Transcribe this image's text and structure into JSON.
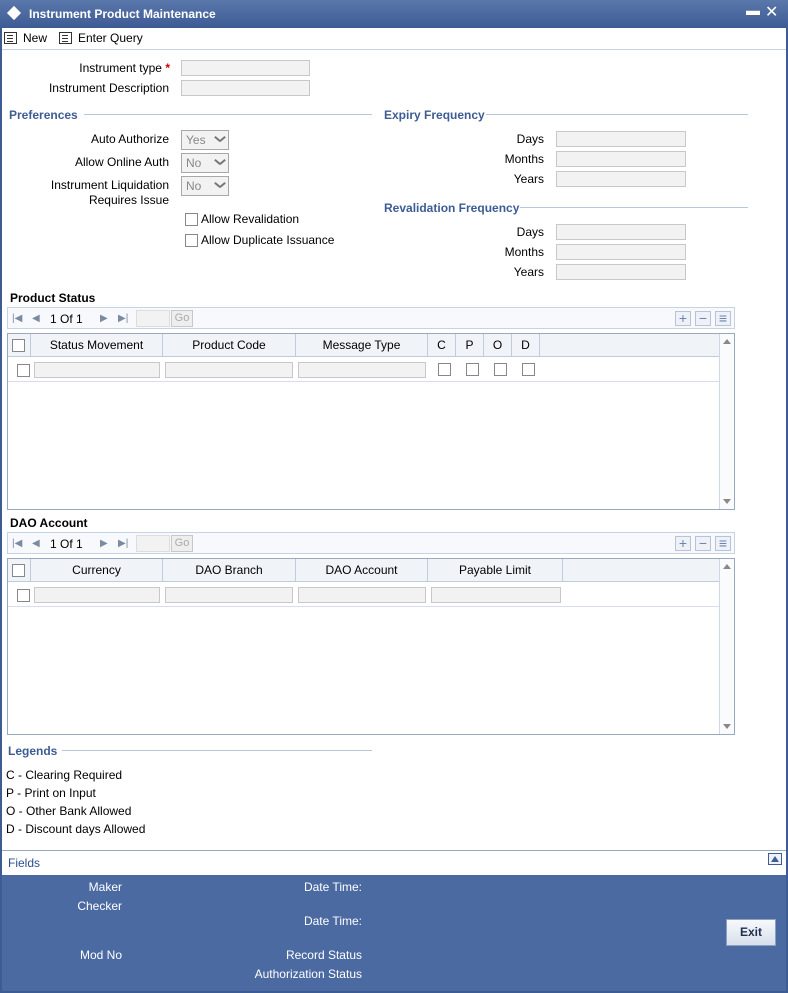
{
  "window": {
    "title": "Instrument Product Maintenance",
    "minimize": "▬",
    "close": "✕"
  },
  "toolbar": {
    "new_label": "New",
    "enter_query_label": "Enter Query"
  },
  "form": {
    "instrument_type_label": "Instrument type",
    "required_mark": "*",
    "instrument_description_label": "Instrument Description"
  },
  "preferences": {
    "title": "Preferences",
    "auto_authorize_label": "Auto Authorize",
    "auto_authorize_value": "Yes",
    "allow_online_auth_label": "Allow Online Auth",
    "allow_online_auth_value": "No",
    "liquidation_label_1": "Instrument Liquidation",
    "liquidation_label_2": "Requires Issue",
    "liquidation_value": "No",
    "allow_revalidation_label": "Allow Revalidation",
    "allow_duplicate_label": "Allow Duplicate Issuance"
  },
  "expiry": {
    "title": "Expiry Frequency",
    "days": "Days",
    "months": "Months",
    "years": "Years"
  },
  "revalidation": {
    "title": "Revalidation Frequency",
    "days": "Days",
    "months": "Months",
    "years": "Years"
  },
  "product_status": {
    "title": "Product Status",
    "pager": "1 Of 1",
    "go": "Go",
    "columns": [
      "Status Movement",
      "Product Code",
      "Message Type",
      "C",
      "P",
      "O",
      "D"
    ]
  },
  "dao_account": {
    "title": "DAO Account",
    "pager": "1 Of 1",
    "go": "Go",
    "columns": [
      "Currency",
      "DAO Branch",
      "DAO Account",
      "Payable Limit"
    ]
  },
  "legends": {
    "title": "Legends",
    "items": [
      "C - Clearing Required",
      "P - Print on Input",
      "O - Other Bank Allowed",
      "D - Discount days Allowed"
    ]
  },
  "fields_label": "Fields",
  "footer": {
    "maker": "Maker",
    "checker": "Checker",
    "mod_no": "Mod No",
    "date_time_1": "Date Time:",
    "date_time_2": "Date Time:",
    "record_status": "Record Status",
    "authorization_status": "Authorization Status",
    "exit_label": "Exit"
  },
  "colors": {
    "titlebar": "#3d5c94",
    "section": "#3d5c94",
    "footer": "#4b6aa1",
    "required": "#cc0000"
  }
}
